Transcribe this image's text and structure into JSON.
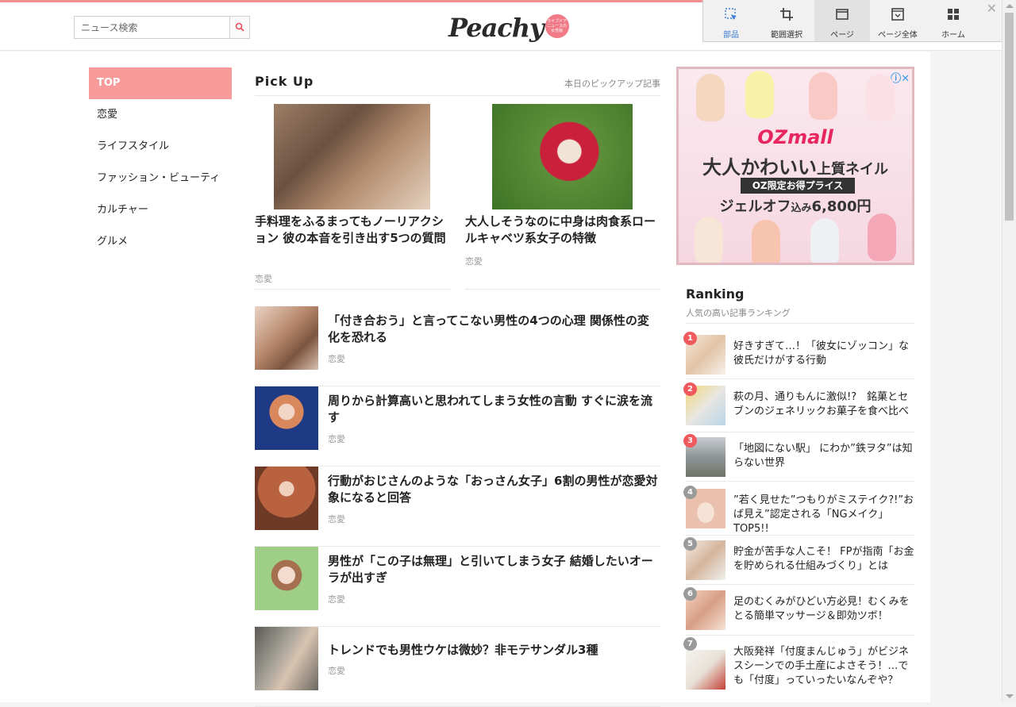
{
  "search": {
    "placeholder": "ニュース検索"
  },
  "logo": {
    "text": "Peachy",
    "badge": "ライブドア ニュースの 女性版"
  },
  "capture_toolbar": [
    {
      "label": "部品",
      "icon": "select-element-icon"
    },
    {
      "label": "範囲選択",
      "icon": "crop-icon"
    },
    {
      "label": "ページ",
      "icon": "page-icon"
    },
    {
      "label": "ページ全体",
      "icon": "full-page-icon"
    },
    {
      "label": "ホーム",
      "icon": "home-grid-icon"
    }
  ],
  "nav": [
    "TOP",
    "恋愛",
    "ライフスタイル",
    "ファッション・ビューティ",
    "カルチャー",
    "グルメ"
  ],
  "pickup": {
    "title": "Pick Up",
    "subtitle": "本日のピックアップ記事",
    "items": [
      {
        "title": "手料理をふるまってもノーリアクション 彼の本音を引き出す5つの質問",
        "category": "恋愛"
      },
      {
        "title": "大人しそうなのに中身は肉食系ロールキャベツ系女子の特徴",
        "category": "恋愛"
      }
    ]
  },
  "articles": [
    {
      "title": "「付き合おう」と言ってこない男性の4つの心理 関係性の変化を恐れる",
      "category": "恋愛"
    },
    {
      "title": "周りから計算高いと思われてしまう女性の言動 すぐに涙を流す",
      "category": "恋愛"
    },
    {
      "title": "行動がおじさんのような「おっさん女子」6割の男性が恋愛対象になると回答",
      "category": "恋愛"
    },
    {
      "title": "男性が「この子は無理」と引いてしまう女子 結婚したいオーラが出すぎ",
      "category": "恋愛"
    },
    {
      "title": "トレンドでも男性ウケは微妙？非モテサンダル3種",
      "category": "恋愛"
    }
  ],
  "ad": {
    "brand": "OZmall",
    "headline": "大人かわいい",
    "headline_small": "上質ネイル",
    "tag": "OZ限定お得プライス",
    "price_prefix": "ジェルオフ",
    "price_mid": "込み",
    "price": "6,800円"
  },
  "ranking": {
    "title": "Ranking",
    "subtitle": "人気の高い記事ランキング",
    "items": [
      {
        "rank": "1",
        "text": "好きすぎて…！「彼女にゾッコン」な彼氏だけがする行動"
      },
      {
        "rank": "2",
        "text": "萩の月、通りもんに激似!?　銘菓とセブンのジェネリックお菓子を食べ比べ"
      },
      {
        "rank": "3",
        "text": "「地図にない駅」 にわか”鉄ヲタ”は知らない世界"
      },
      {
        "rank": "4",
        "text": "”若く見せた”つもりがミステイク?!”おば見え”認定される「NGメイク」TOP5!!"
      },
      {
        "rank": "5",
        "text": "貯金が苦手な人こそ！ FPが指南「お金を貯められる仕組みづくり」とは"
      },
      {
        "rank": "6",
        "text": "足のむくみがひどい方必見！むくみをとる簡単マッサージ＆即効ツボ！"
      },
      {
        "rank": "7",
        "text": "大阪発祥「付度まんじゅう」がビジネスシーンでの手土産によさそう！…でも「付度」っていったいなんぞや？"
      }
    ]
  }
}
